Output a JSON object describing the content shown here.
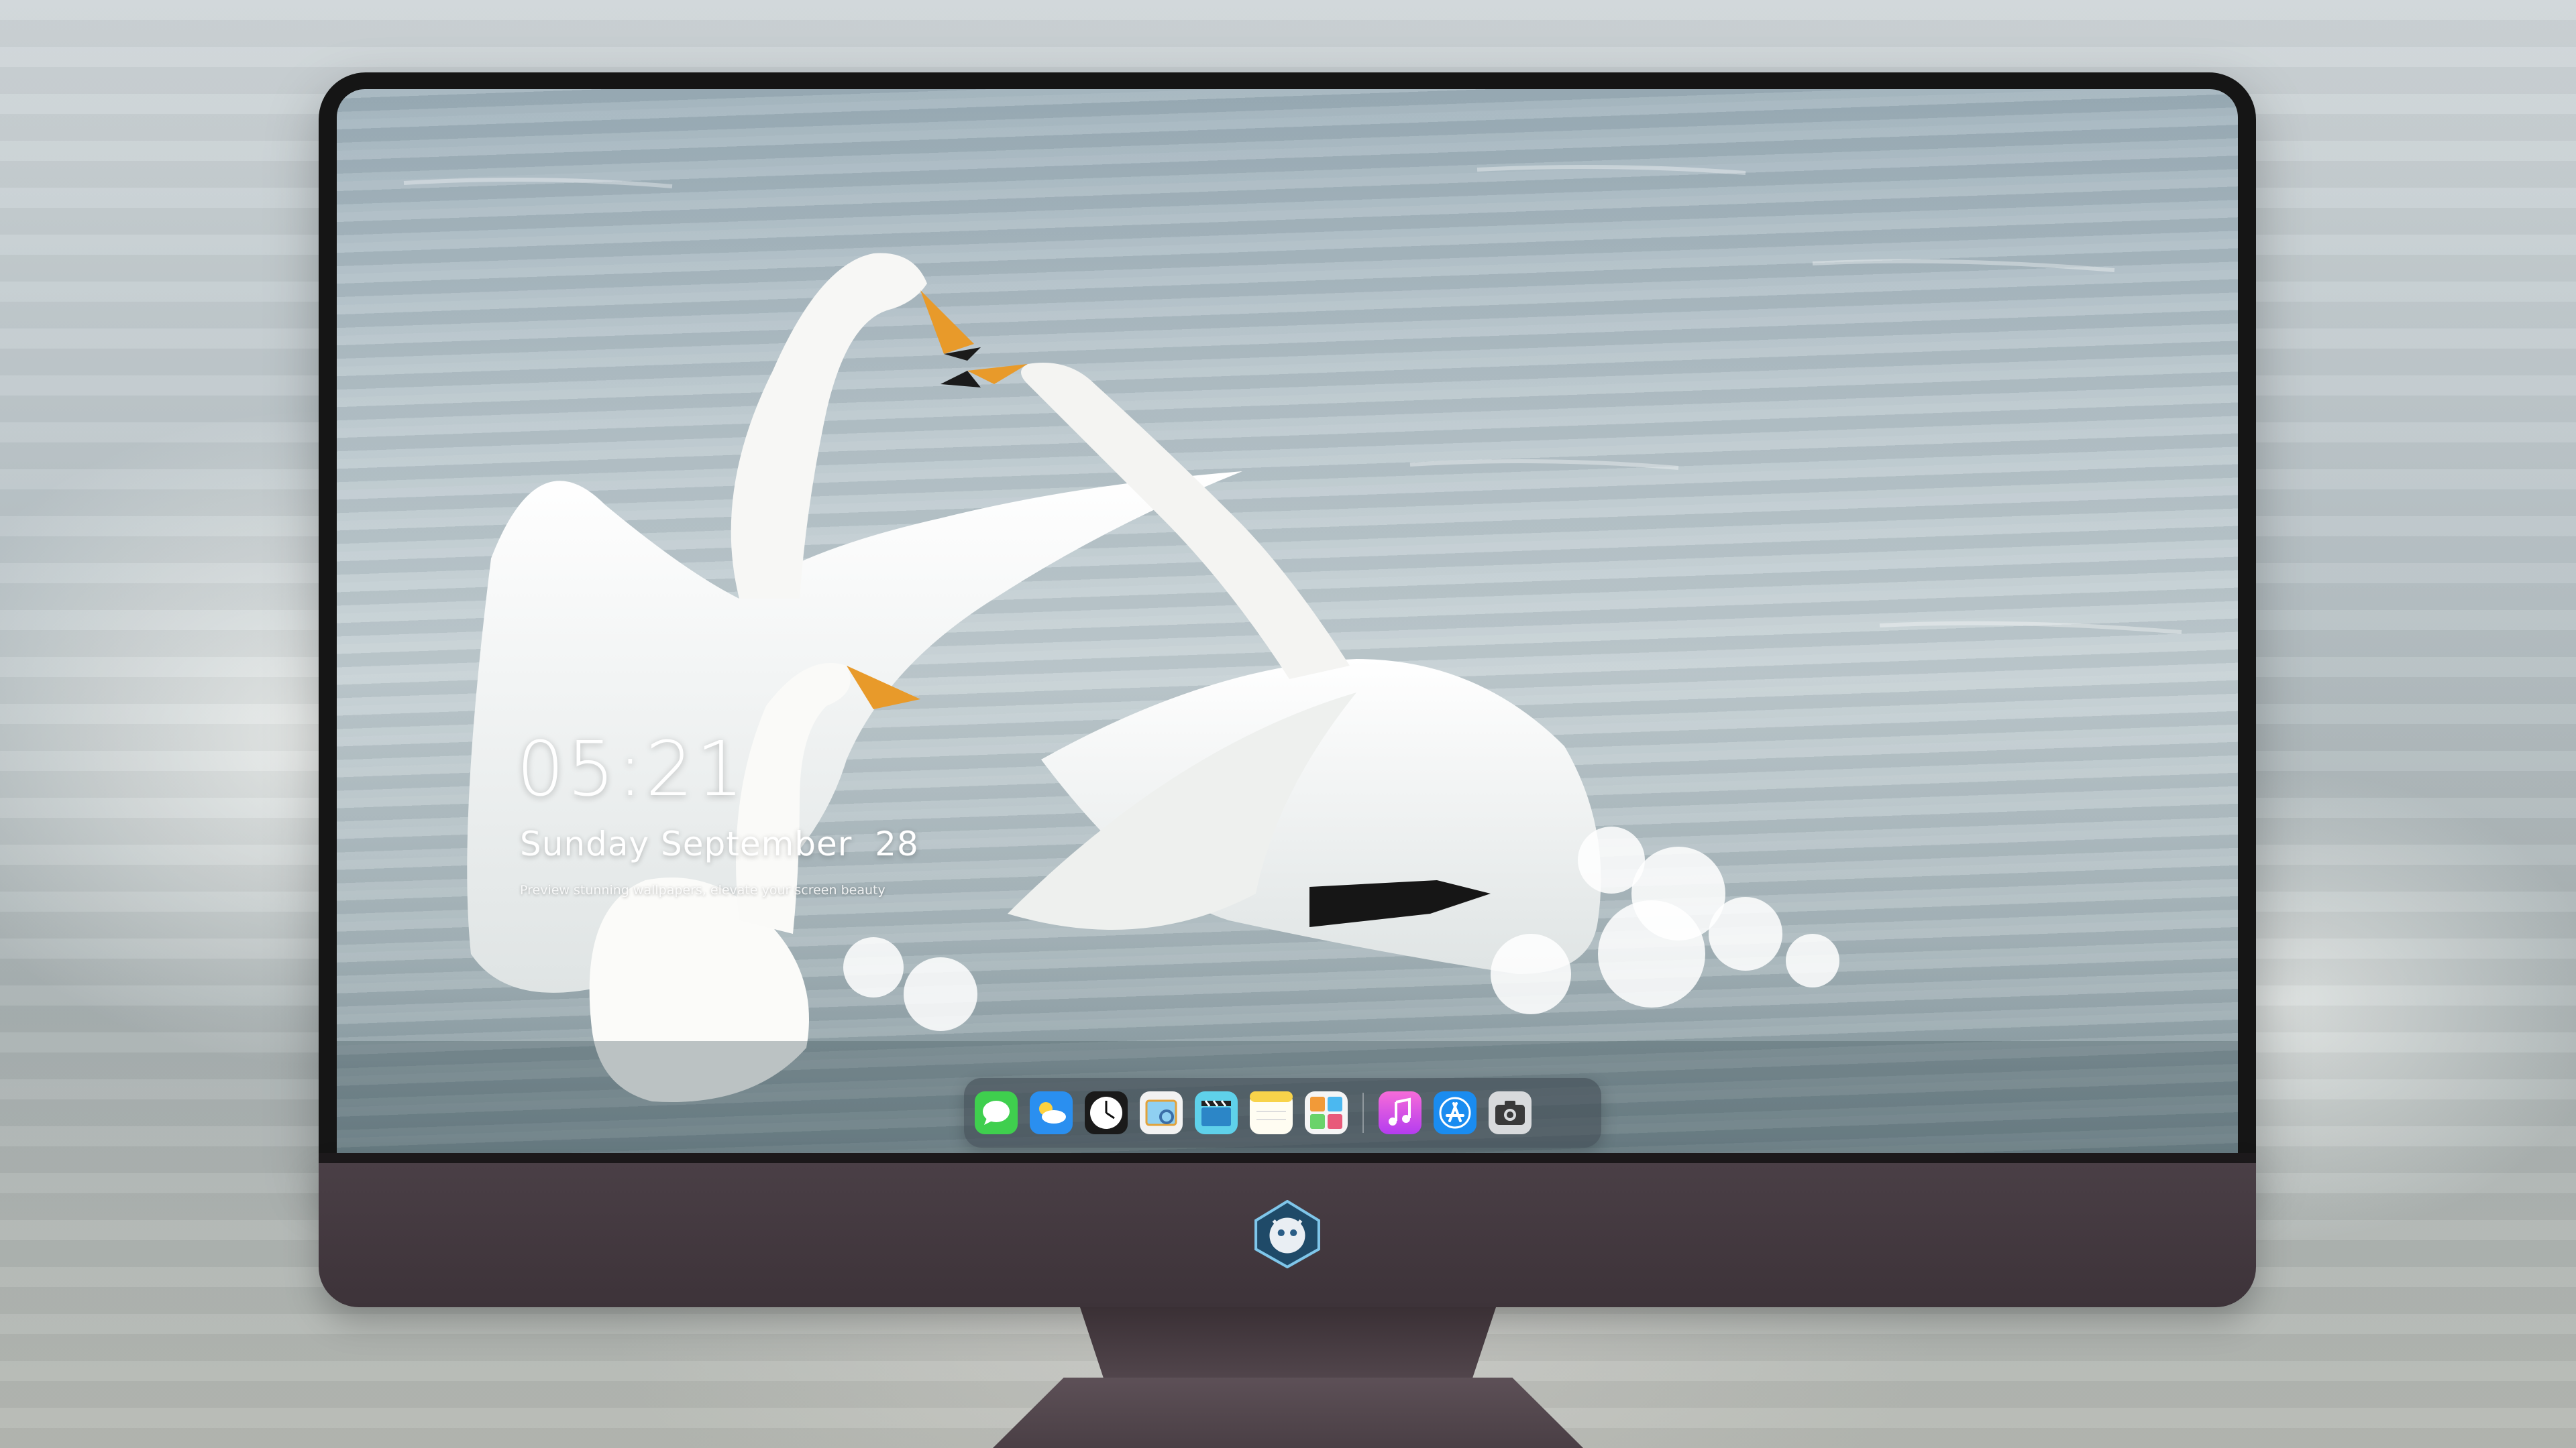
{
  "lock_screen": {
    "time": "05:21",
    "date": "Sunday September  28",
    "caption": "Preview stunning wallpapers, elevate your screen beauty"
  },
  "dock": {
    "apps": [
      {
        "name": "Messages",
        "icon": "messages-icon"
      },
      {
        "name": "Weather",
        "icon": "weather-icon"
      },
      {
        "name": "Clock",
        "icon": "clock-icon"
      },
      {
        "name": "Preview",
        "icon": "preview-icon"
      },
      {
        "name": "Clips",
        "icon": "clapperboard-icon"
      },
      {
        "name": "Notes",
        "icon": "notes-icon"
      },
      {
        "name": "Photos Gallery",
        "icon": "gallery-icon"
      },
      {
        "name": "Music",
        "icon": "music-icon"
      },
      {
        "name": "App Store",
        "icon": "app-store-icon"
      },
      {
        "name": "Camera",
        "icon": "camera-icon"
      }
    ]
  },
  "colors": {
    "chin": "#4a3f46",
    "bezel": "#151515",
    "water": "#b9c6cc"
  }
}
